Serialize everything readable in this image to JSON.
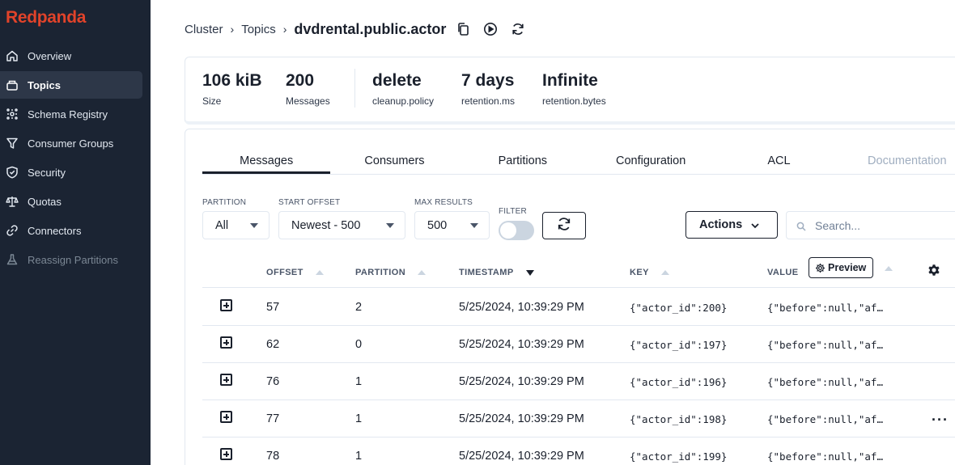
{
  "app": {
    "logo": "Redpanda",
    "brand_color": "#e1432a"
  },
  "sidebar": {
    "items": [
      {
        "label": "Overview",
        "icon": "home-icon",
        "active": false,
        "disabled": false
      },
      {
        "label": "Topics",
        "icon": "topics-icon",
        "active": true,
        "disabled": false
      },
      {
        "label": "Schema Registry",
        "icon": "schema-registry-icon",
        "active": false,
        "disabled": false
      },
      {
        "label": "Consumer Groups",
        "icon": "filter-funnel-icon",
        "active": false,
        "disabled": false
      },
      {
        "label": "Security",
        "icon": "shield-icon",
        "active": false,
        "disabled": false
      },
      {
        "label": "Quotas",
        "icon": "scale-icon",
        "active": false,
        "disabled": false
      },
      {
        "label": "Connectors",
        "icon": "link-icon",
        "active": false,
        "disabled": false
      },
      {
        "label": "Reassign Partitions",
        "icon": "flask-icon",
        "active": false,
        "disabled": true
      }
    ]
  },
  "breadcrumb": {
    "cluster": "Cluster",
    "topics": "Topics",
    "current": "dvdrental.public.actor"
  },
  "stats": [
    {
      "value": "106 kiB",
      "label": "Size"
    },
    {
      "value": "200",
      "label": "Messages"
    },
    {
      "value": "delete",
      "label": "cleanup.policy"
    },
    {
      "value": "7 days",
      "label": "retention.ms"
    },
    {
      "value": "Infinite",
      "label": "retention.bytes"
    }
  ],
  "tabs": [
    {
      "label": "Messages",
      "active": true
    },
    {
      "label": "Consumers"
    },
    {
      "label": "Partitions"
    },
    {
      "label": "Configuration"
    },
    {
      "label": "ACL"
    },
    {
      "label": "Documentation",
      "muted": true
    }
  ],
  "filters": {
    "partition": {
      "label": "PARTITION",
      "value": "All"
    },
    "start_offset": {
      "label": "START OFFSET",
      "value": "Newest - 500"
    },
    "max_results": {
      "label": "MAX RESULTS",
      "value": "500"
    },
    "filter": {
      "label": "FILTER",
      "enabled": false
    },
    "actions_label": "Actions",
    "search_placeholder": "Search..."
  },
  "table": {
    "columns": {
      "offset": "OFFSET",
      "partition": "PARTITION",
      "timestamp": "TIMESTAMP",
      "key": "KEY",
      "value": "VALUE",
      "preview": "Preview"
    },
    "rows": [
      {
        "offset": "57",
        "partition": "2",
        "timestamp": "5/25/2024, 10:39:29 PM",
        "key": "{\"actor_id\":200}",
        "value": "{\"before\":null,\"af…"
      },
      {
        "offset": "62",
        "partition": "0",
        "timestamp": "5/25/2024, 10:39:29 PM",
        "key": "{\"actor_id\":197}",
        "value": "{\"before\":null,\"af…"
      },
      {
        "offset": "76",
        "partition": "1",
        "timestamp": "5/25/2024, 10:39:29 PM",
        "key": "{\"actor_id\":196}",
        "value": "{\"before\":null,\"af…"
      },
      {
        "offset": "77",
        "partition": "1",
        "timestamp": "5/25/2024, 10:39:29 PM",
        "key": "{\"actor_id\":198}",
        "value": "{\"before\":null,\"af…",
        "menu": "···"
      },
      {
        "offset": "78",
        "partition": "1",
        "timestamp": "5/25/2024, 10:39:29 PM",
        "key": "{\"actor_id\":199}",
        "value": "{\"before\":null,\"af…"
      }
    ]
  }
}
